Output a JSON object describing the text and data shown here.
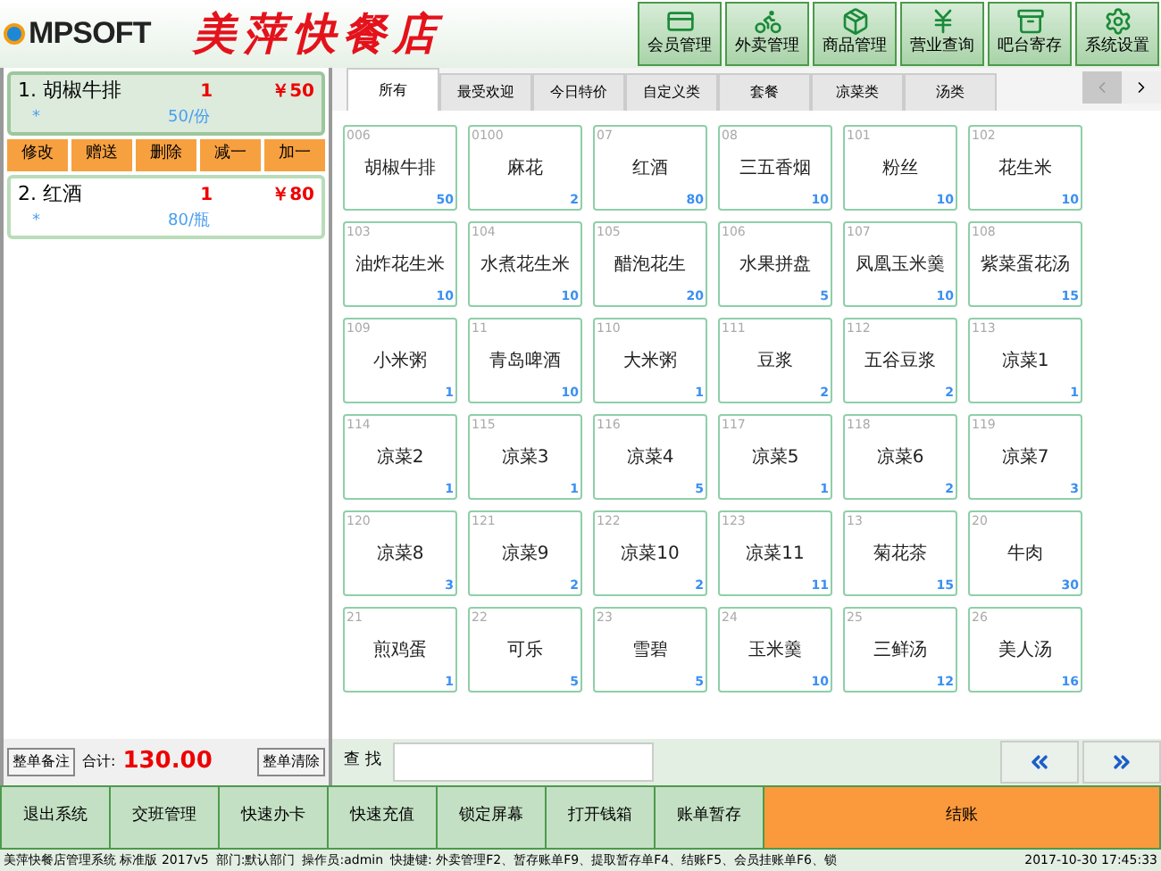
{
  "header": {
    "logo": "MPSOFT",
    "shop_name": "美萍快餐店",
    "toolbar": [
      {
        "label": "会员管理",
        "kind": "card"
      },
      {
        "label": "外卖管理",
        "kind": "delivery"
      },
      {
        "label": "商品管理",
        "kind": "goods"
      },
      {
        "label": "营业查询",
        "kind": "money"
      },
      {
        "label": "吧台寄存",
        "kind": "store"
      },
      {
        "label": "系统设置",
        "kind": "gear"
      }
    ]
  },
  "order": {
    "items": [
      {
        "name": "1. 胡椒牛排",
        "qty": "1",
        "price": "￥50",
        "note": "*",
        "unit_price": "50/份",
        "selected": true
      },
      {
        "name": "2. 红酒",
        "qty": "1",
        "price": "￥80",
        "note": "*",
        "unit_price": "80/瓶",
        "selected": false
      }
    ],
    "item_actions": [
      "修改",
      "赠送",
      "删除",
      "减一",
      "加一"
    ],
    "note_button": "整单备注",
    "total_label": "合计:",
    "total": "130.00",
    "clear_button": "整单清除"
  },
  "tabs": [
    {
      "label": "所有",
      "selected": true
    },
    {
      "label": "最受欢迎",
      "selected": false
    },
    {
      "label": "今日特价",
      "selected": false
    },
    {
      "label": "自定义类",
      "selected": false
    },
    {
      "label": "套餐",
      "selected": false
    },
    {
      "label": "凉菜类",
      "selected": false
    },
    {
      "label": "汤类",
      "selected": false
    }
  ],
  "products": [
    {
      "code": "006",
      "name": "胡椒牛排",
      "stock": "50"
    },
    {
      "code": "0100",
      "name": "麻花",
      "stock": "2"
    },
    {
      "code": "07",
      "name": "红酒",
      "stock": "80"
    },
    {
      "code": "08",
      "name": "三五香烟",
      "stock": "10"
    },
    {
      "code": "101",
      "name": "粉丝",
      "stock": "10"
    },
    {
      "code": "102",
      "name": "花生米",
      "stock": "10"
    },
    {
      "code": "103",
      "name": "油炸花生米",
      "stock": "10"
    },
    {
      "code": "104",
      "name": "水煮花生米",
      "stock": "10"
    },
    {
      "code": "105",
      "name": "醋泡花生",
      "stock": "20"
    },
    {
      "code": "106",
      "name": "水果拼盘",
      "stock": "5"
    },
    {
      "code": "107",
      "name": "凤凰玉米羹",
      "stock": "10"
    },
    {
      "code": "108",
      "name": "紫菜蛋花汤",
      "stock": "15"
    },
    {
      "code": "109",
      "name": "小米粥",
      "stock": "1"
    },
    {
      "code": "11",
      "name": "青岛啤酒",
      "stock": "10"
    },
    {
      "code": "110",
      "name": "大米粥",
      "stock": "1"
    },
    {
      "code": "111",
      "name": "豆浆",
      "stock": "2"
    },
    {
      "code": "112",
      "name": "五谷豆浆",
      "stock": "2"
    },
    {
      "code": "113",
      "name": "凉菜1",
      "stock": "1"
    },
    {
      "code": "114",
      "name": "凉菜2",
      "stock": "1"
    },
    {
      "code": "115",
      "name": "凉菜3",
      "stock": "1"
    },
    {
      "code": "116",
      "name": "凉菜4",
      "stock": "5"
    },
    {
      "code": "117",
      "name": "凉菜5",
      "stock": "1"
    },
    {
      "code": "118",
      "name": "凉菜6",
      "stock": "2"
    },
    {
      "code": "119",
      "name": "凉菜7",
      "stock": "3"
    },
    {
      "code": "120",
      "name": "凉菜8",
      "stock": "3"
    },
    {
      "code": "121",
      "name": "凉菜9",
      "stock": "2"
    },
    {
      "code": "122",
      "name": "凉菜10",
      "stock": "2"
    },
    {
      "code": "123",
      "name": "凉菜11",
      "stock": "11"
    },
    {
      "code": "13",
      "name": "菊花茶",
      "stock": "15"
    },
    {
      "code": "20",
      "name": "牛肉",
      "stock": "30"
    },
    {
      "code": "21",
      "name": "煎鸡蛋",
      "stock": "1"
    },
    {
      "code": "22",
      "name": "可乐",
      "stock": "5"
    },
    {
      "code": "23",
      "name": "雪碧",
      "stock": "5"
    },
    {
      "code": "24",
      "name": "玉米羹",
      "stock": "10"
    },
    {
      "code": "25",
      "name": "三鲜汤",
      "stock": "12"
    },
    {
      "code": "26",
      "name": "美人汤",
      "stock": "16"
    }
  ],
  "search": {
    "label": "查 找"
  },
  "actions": [
    {
      "label": "退出系统",
      "kind": "normal"
    },
    {
      "label": "交班管理",
      "kind": "normal"
    },
    {
      "label": "快速办卡",
      "kind": "normal"
    },
    {
      "label": "快速充值",
      "kind": "normal"
    },
    {
      "label": "锁定屏幕",
      "kind": "normal"
    },
    {
      "label": "打开钱箱",
      "kind": "normal"
    },
    {
      "label": "账单暂存",
      "kind": "normal"
    },
    {
      "label": "结账",
      "kind": "primary"
    }
  ],
  "status_bar": [
    "美萍快餐店管理系统 标准版 2017v5",
    "部门:默认部门",
    "操作员:admin",
    "快捷键: 外卖管理F2、暂存账单F9、提取暂存单F4、结账F5、会员挂账单F6、锁",
    "2017-10-30 17:45:33"
  ]
}
